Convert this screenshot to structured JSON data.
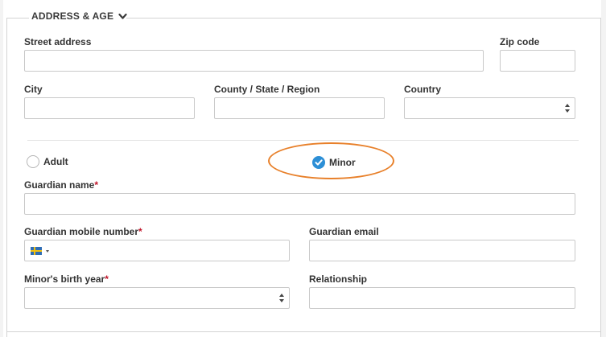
{
  "section": {
    "title": "ADDRESS & AGE"
  },
  "fields": {
    "street_address": {
      "label": "Street address",
      "value": ""
    },
    "zip_code": {
      "label": "Zip code",
      "value": ""
    },
    "city": {
      "label": "City",
      "value": ""
    },
    "county": {
      "label": "County / State / Region",
      "value": ""
    },
    "country": {
      "label": "Country",
      "value": ""
    },
    "guardian_name": {
      "label": "Guardian name",
      "required_mark": "*",
      "value": ""
    },
    "guardian_mobile": {
      "label": "Guardian mobile number",
      "required_mark": "*",
      "value": "",
      "country_flag": "sweden-flag-icon"
    },
    "guardian_email": {
      "label": "Guardian email",
      "value": ""
    },
    "minor_birth_year": {
      "label": "Minor's birth year",
      "required_mark": "*",
      "value": ""
    },
    "relationship": {
      "label": "Relationship",
      "value": ""
    }
  },
  "age_options": [
    {
      "label": "Adult",
      "selected": false
    },
    {
      "label": "Minor",
      "selected": true
    }
  ],
  "colors": {
    "accent": "#2c8fd6",
    "highlight": "#e8802a",
    "required": "#c0152a"
  }
}
